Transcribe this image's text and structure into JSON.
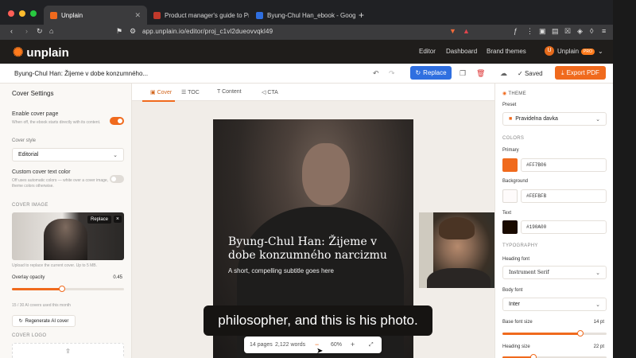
{
  "browser": {
    "tabs": [
      {
        "label": "Unplain",
        "color": "#f06a1d"
      },
      {
        "label": "Product manager's guide to Prod",
        "color": "#c0392b"
      },
      {
        "label": "Byung-Chul Han_ebook - Google",
        "color": "#2f6fe0"
      }
    ],
    "url": "app.unplain.io/editor/proj_c1vl2dueovvqkl49",
    "new_tab": "+"
  },
  "app": {
    "brand": "unplain",
    "nav": [
      "Editor",
      "Dashboard",
      "Brand themes"
    ],
    "user": {
      "initial": "U",
      "name": "Unplain",
      "badge": "PRO"
    }
  },
  "toolbar": {
    "doc_title": "Byung-Chul Han: Žijeme v dobe konzumného...",
    "replace": "Replace",
    "saved": "Saved",
    "export": "Export PDF"
  },
  "cover_settings": {
    "heading": "Cover Settings",
    "enable_label": "Enable cover page",
    "enable_help": "When off, the ebook starts directly with its content.",
    "enable_on": true,
    "style_label": "Cover style",
    "style_value": "Editorial",
    "custom_color_label": "Custom cover text color",
    "custom_color_help": "Off uses automatic colors — white over a cover image, theme colors otherwise.",
    "custom_color_on": false,
    "cover_image_section": "COVER IMAGE",
    "image_replace": "Replace",
    "image_remove": "×",
    "upload_help": "Upload to replace the current cover. Up to 5 MB.",
    "overlay_label": "Overlay opacity",
    "overlay_value": "0.45",
    "overlay_fraction": 0.45,
    "ai_usage": "15 / 30 AI covers used this month",
    "regen": "Regenerate AI cover",
    "logo_section": "COVER LOGO",
    "logo_upload_icon": "⇪"
  },
  "editor_tabs": [
    "Cover",
    "TOC",
    "Content",
    "CTA"
  ],
  "cover": {
    "title": "Byung-Chul Han: Žijeme v dobe konzumného narcizmu",
    "subtitle": "A short, compelling subtitle goes here"
  },
  "caption": "philosopher, and this is his photo.",
  "zoom": {
    "pages": "14 pages",
    "words": "2,122 words",
    "minus": "−",
    "level": "60%",
    "plus": "+",
    "fit": "⤢"
  },
  "theme": {
    "heading": "THEME",
    "preset_label": "Preset",
    "preset_value": "Pravidelna davka",
    "colors_section": "COLORS",
    "primary_label": "Primary",
    "primary_hex": "#FF7B06",
    "background_label": "Background",
    "background_hex": "#FEFBFB",
    "text_label": "Text",
    "text_hex": "#190A00",
    "typography_section": "TYPOGRAPHY",
    "heading_font_label": "Heading font",
    "heading_font_value": "Instrument Serif",
    "body_font_label": "Body font",
    "body_font_value": "Inter",
    "base_size_label": "Base font size",
    "base_size_value": "14 pt",
    "base_size_fraction": 0.75,
    "heading_size_label": "Heading size",
    "heading_size_value": "22 pt",
    "heading_size_fraction": 0.3
  }
}
